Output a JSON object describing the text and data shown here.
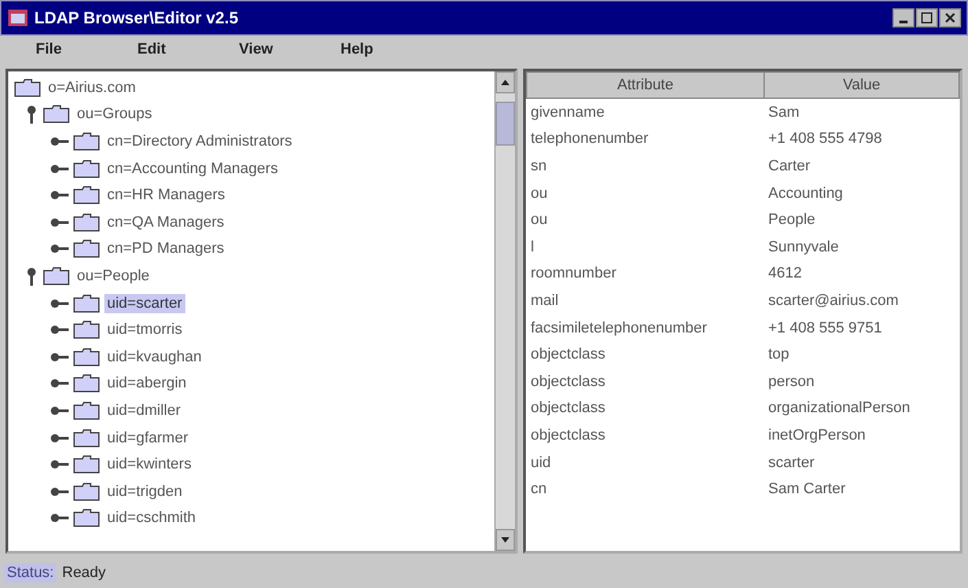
{
  "window": {
    "title": "LDAP Browser\\Editor v2.5"
  },
  "menu": [
    "File",
    "Edit",
    "View",
    "Help"
  ],
  "tree": [
    {
      "label": "o=Airius.com",
      "selected": false,
      "children": [
        {
          "label": "ou=Groups",
          "expanded": true,
          "selected": false,
          "children": [
            {
              "label": "cn=Directory Administrators",
              "expanded": false,
              "selected": false
            },
            {
              "label": "cn=Accounting Managers",
              "expanded": false,
              "selected": false
            },
            {
              "label": "cn=HR Managers",
              "expanded": false,
              "selected": false
            },
            {
              "label": "cn=QA Managers",
              "expanded": false,
              "selected": false
            },
            {
              "label": "cn=PD Managers",
              "expanded": false,
              "selected": false
            }
          ]
        },
        {
          "label": "ou=People",
          "expanded": true,
          "selected": false,
          "children": [
            {
              "label": "uid=scarter",
              "expanded": false,
              "selected": true
            },
            {
              "label": "uid=tmorris",
              "expanded": false,
              "selected": false
            },
            {
              "label": "uid=kvaughan",
              "expanded": false,
              "selected": false
            },
            {
              "label": "uid=abergin",
              "expanded": false,
              "selected": false
            },
            {
              "label": "uid=dmiller",
              "expanded": false,
              "selected": false
            },
            {
              "label": "uid=gfarmer",
              "expanded": false,
              "selected": false
            },
            {
              "label": "uid=kwinters",
              "expanded": false,
              "selected": false
            },
            {
              "label": "uid=trigden",
              "expanded": false,
              "selected": false
            },
            {
              "label": "uid=cschmith",
              "expanded": false,
              "selected": false
            }
          ]
        }
      ]
    }
  ],
  "table": {
    "columns": [
      "Attribute",
      "Value"
    ],
    "rows": [
      [
        "givenname",
        "Sam"
      ],
      [
        "telephonenumber",
        "+1 408 555 4798"
      ],
      [
        "sn",
        "Carter"
      ],
      [
        "ou",
        "Accounting"
      ],
      [
        "ou",
        "People"
      ],
      [
        "l",
        "Sunnyvale"
      ],
      [
        "roomnumber",
        "4612"
      ],
      [
        "mail",
        "scarter@airius.com"
      ],
      [
        "facsimiletelephonenumber",
        "+1 408 555 9751"
      ],
      [
        "objectclass",
        "top"
      ],
      [
        "objectclass",
        "person"
      ],
      [
        "objectclass",
        "organizationalPerson"
      ],
      [
        "objectclass",
        "inetOrgPerson"
      ],
      [
        "uid",
        "scarter"
      ],
      [
        "cn",
        "Sam Carter"
      ]
    ]
  },
  "status_bar": {
    "label": "Status:",
    "text": "Ready"
  }
}
